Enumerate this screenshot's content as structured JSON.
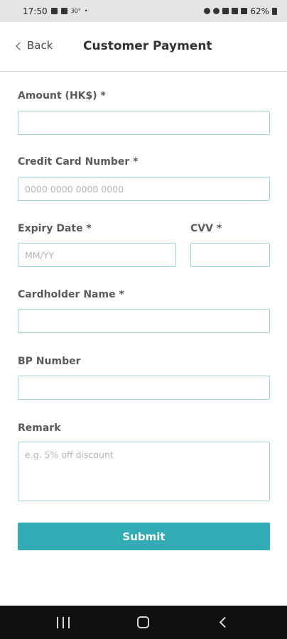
{
  "status_bar": {
    "time": "17:50",
    "temperature": "30°",
    "battery": "62%"
  },
  "header": {
    "back_label": "Back",
    "title": "Customer Payment"
  },
  "form": {
    "amount": {
      "label": "Amount (HK$) *",
      "value": "",
      "placeholder": ""
    },
    "card_number": {
      "label": "Credit Card Number *",
      "value": "",
      "placeholder": "0000 0000 0000 0000"
    },
    "expiry": {
      "label": "Expiry Date *",
      "value": "",
      "placeholder": "MM/YY"
    },
    "cvv": {
      "label": "CVV *",
      "value": "",
      "placeholder": ""
    },
    "cardholder": {
      "label": "Cardholder Name *",
      "value": "",
      "placeholder": ""
    },
    "bp_number": {
      "label": "BP Number",
      "value": "",
      "placeholder": ""
    },
    "remark": {
      "label": "Remark",
      "value": "",
      "placeholder": "e.g. 5% off discount"
    },
    "submit_label": "Submit"
  },
  "colors": {
    "accent": "#31acb5",
    "input_border": "#9fd7d6",
    "status_bar": "#e4e4e4",
    "nav_bar": "#101010"
  },
  "icons": {
    "status": [
      "image-icon",
      "message-icon",
      "alarm-icon",
      "mute-icon",
      "wifi-icon",
      "signal-icon",
      "battery-icon"
    ],
    "nav": [
      "recent-apps-icon",
      "home-icon",
      "nav-back-icon"
    ]
  }
}
